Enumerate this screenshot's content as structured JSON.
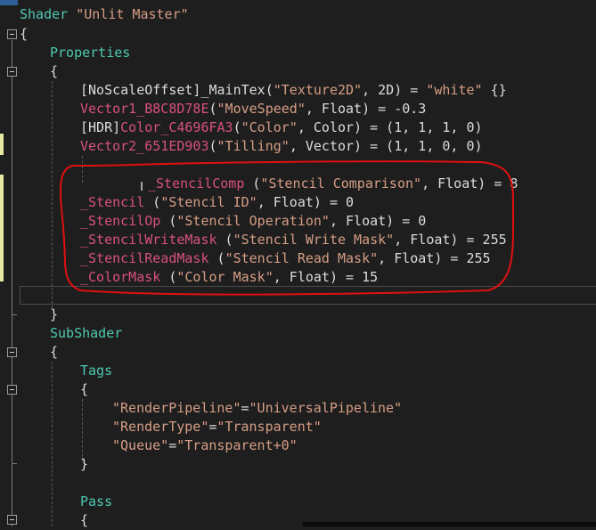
{
  "editor": {
    "lines": [
      {
        "tokens": [
          {
            "t": "Shader ",
            "c": "kw"
          },
          {
            "t": "\"Unlit Master\"",
            "c": "str"
          }
        ]
      },
      {
        "tokens": [
          {
            "t": "{",
            "c": "plain"
          }
        ]
      },
      {
        "tokens": [
          {
            "t": "Properties",
            "c": "kw"
          }
        ]
      },
      {
        "tokens": [
          {
            "t": "{",
            "c": "plain"
          }
        ]
      },
      {
        "tokens": [
          {
            "t": "[NoScaleOffset]_MainTex(",
            "c": "plain"
          },
          {
            "t": "\"Texture2D\"",
            "c": "str"
          },
          {
            "t": ", 2D) = ",
            "c": "plain"
          },
          {
            "t": "\"white\"",
            "c": "str"
          },
          {
            "t": " {}",
            "c": "plain"
          }
        ]
      },
      {
        "tokens": [
          {
            "t": "Vector1_B8C8D78E",
            "c": "prop"
          },
          {
            "t": "(",
            "c": "plain"
          },
          {
            "t": "\"MoveSpeed\"",
            "c": "str"
          },
          {
            "t": ", Float) = -0.3",
            "c": "plain"
          }
        ]
      },
      {
        "tokens": [
          {
            "t": "[HDR]",
            "c": "plain"
          },
          {
            "t": "Color_C4696FA3",
            "c": "prop"
          },
          {
            "t": "(",
            "c": "plain"
          },
          {
            "t": "\"Color\"",
            "c": "str"
          },
          {
            "t": ", Color) = (1, 1, 1, 0)",
            "c": "plain"
          }
        ]
      },
      {
        "tokens": [
          {
            "t": "Vector2_651ED903",
            "c": "prop"
          },
          {
            "t": "(",
            "c": "plain"
          },
          {
            "t": "\"Tilling\"",
            "c": "str"
          },
          {
            "t": ", Vector) = (1, 1, 0, 0)",
            "c": "plain"
          }
        ]
      },
      {
        "tokens": []
      },
      {
        "tokens": [
          {
            "t": "_StencilComp",
            "c": "prop"
          },
          {
            "t": " (",
            "c": "plain"
          },
          {
            "t": "\"Stencil Comparison\"",
            "c": "str"
          },
          {
            "t": ", Float) = 8",
            "c": "plain"
          }
        ]
      },
      {
        "tokens": [
          {
            "t": "_Stencil",
            "c": "prop"
          },
          {
            "t": " (",
            "c": "plain"
          },
          {
            "t": "\"Stencil ID\"",
            "c": "str"
          },
          {
            "t": ", Float) = 0",
            "c": "plain"
          }
        ]
      },
      {
        "tokens": [
          {
            "t": "_StencilOp",
            "c": "prop"
          },
          {
            "t": " (",
            "c": "plain"
          },
          {
            "t": "\"Stencil Operation\"",
            "c": "str"
          },
          {
            "t": ", Float) = 0",
            "c": "plain"
          }
        ]
      },
      {
        "tokens": [
          {
            "t": "_StencilWriteMask",
            "c": "prop"
          },
          {
            "t": " (",
            "c": "plain"
          },
          {
            "t": "\"Stencil Write Mask\"",
            "c": "str"
          },
          {
            "t": ", Float) = 255",
            "c": "plain"
          }
        ]
      },
      {
        "tokens": [
          {
            "t": "_StencilReadMask",
            "c": "prop"
          },
          {
            "t": " (",
            "c": "plain"
          },
          {
            "t": "\"Stencil Read Mask\"",
            "c": "str"
          },
          {
            "t": ", Float) = 255",
            "c": "plain"
          }
        ]
      },
      {
        "tokens": [
          {
            "t": "_ColorMask",
            "c": "prop"
          },
          {
            "t": " (",
            "c": "plain"
          },
          {
            "t": "\"Color Mask\"",
            "c": "str"
          },
          {
            "t": ", Float) = 15",
            "c": "plain"
          }
        ]
      },
      {
        "tokens": []
      },
      {
        "tokens": [
          {
            "t": "}",
            "c": "plain"
          }
        ]
      },
      {
        "tokens": [
          {
            "t": "SubShader",
            "c": "kw"
          }
        ]
      },
      {
        "tokens": [
          {
            "t": "{",
            "c": "plain"
          }
        ]
      },
      {
        "tokens": [
          {
            "t": "Tags",
            "c": "kw"
          }
        ]
      },
      {
        "tokens": [
          {
            "t": "{",
            "c": "plain"
          }
        ]
      },
      {
        "tokens": [
          {
            "t": "\"RenderPipeline\"",
            "c": "str"
          },
          {
            "t": "=",
            "c": "plain"
          },
          {
            "t": "\"UniversalPipeline\"",
            "c": "str"
          }
        ]
      },
      {
        "tokens": [
          {
            "t": "\"RenderType\"",
            "c": "str"
          },
          {
            "t": "=",
            "c": "plain"
          },
          {
            "t": "\"Transparent\"",
            "c": "str"
          }
        ]
      },
      {
        "tokens": [
          {
            "t": "\"Queue\"",
            "c": "str"
          },
          {
            "t": "=",
            "c": "plain"
          },
          {
            "t": "\"Transparent+0\"",
            "c": "str"
          }
        ]
      },
      {
        "tokens": [
          {
            "t": "}",
            "c": "plain"
          }
        ]
      },
      {
        "tokens": []
      },
      {
        "tokens": [
          {
            "t": "Pass",
            "c": "kw"
          }
        ]
      },
      {
        "tokens": [
          {
            "t": "{",
            "c": "plain"
          }
        ]
      }
    ]
  },
  "colors": {
    "background": "#1e1e1e",
    "keyword": "#4ec9b0",
    "string": "#d69d85",
    "property": "#d85080",
    "annotation": "#e01010"
  }
}
